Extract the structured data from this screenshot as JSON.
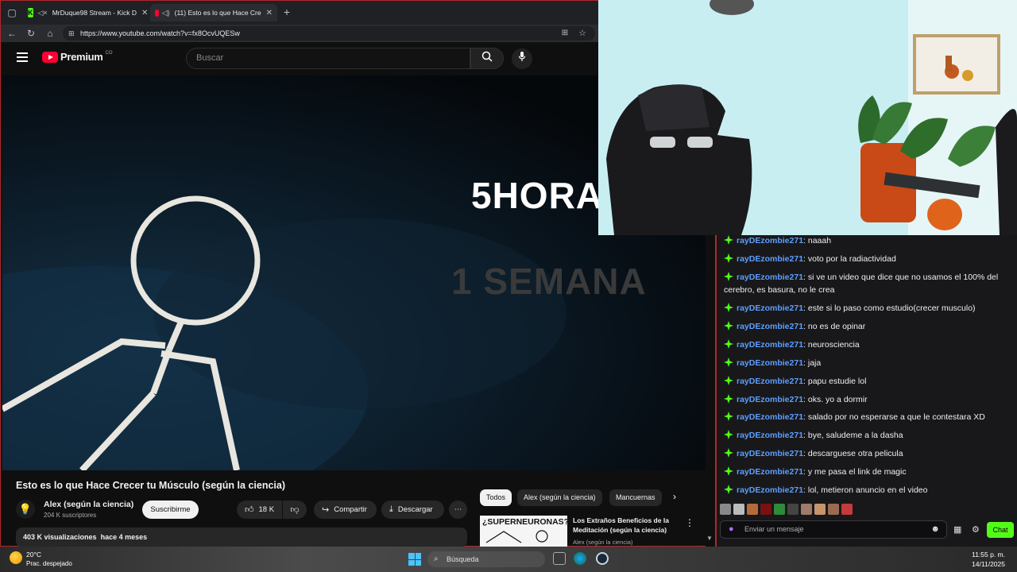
{
  "browser": {
    "tabs": [
      {
        "title": "MrDuque98 Stream - Kick D",
        "favicon": "kick-icon"
      },
      {
        "title": "(11) Esto es lo que Hace Cre",
        "favicon": "youtube-icon",
        "audio": "speaker-icon"
      }
    ],
    "url": "https://www.youtube.com/watch?v=fx8OcvUQESw"
  },
  "youtube": {
    "logo_text": "Premium",
    "logo_superscript": "CO",
    "search_placeholder": "Buscar",
    "video_overlay_text_1": "5HORA",
    "video_overlay_text_2": "1 SEMANA",
    "video_title": "Esto es lo que Hace Crecer tu Músculo (según la ciencia)",
    "channel_name": "Alex (según la ciencia)",
    "subscribers": "204 K suscriptores",
    "subscribe_label": "Suscribirme",
    "likes": "18 K",
    "share_label": "Compartir",
    "download_label": "Descargar",
    "views": "403 K visualizaciones",
    "published": "hace 4 meses",
    "chips": [
      "Todos",
      "Alex (según la ciencia)",
      "Mancuernas"
    ],
    "recommendation": {
      "thumb_text": "¿SUPERNEURONAS?",
      "title": "Los Extraños Beneficios de la Meditación (según la ciencia)",
      "channel": "Alex (según la ciencia)"
    }
  },
  "chat": {
    "username": "rayDEzombie271",
    "accent_color": "#53fc18",
    "name_color": "#5c9fff",
    "messages": [
      ": naaah",
      ": voto por la radiactividad",
      ": si ve un video que dice que no usamos el 100% del cerebro, es basura, no le crea",
      ": este si lo paso como estudio(crecer musculo)",
      ": no es de opinar",
      ": neurosciencia",
      ": jaja",
      ": papu estudie lol",
      ": oks. yo a dormir",
      ": salado por no esperarse a que le contestara XD",
      ": bye, saludeme a la dasha",
      ": descarguese otra pelicula",
      ": y me pasa el link de magic",
      ": lol, metieron anuncio en el video"
    ],
    "input_placeholder": "Enviar un mensaje",
    "send_label": "Chat"
  },
  "taskbar": {
    "temperature": "20°C",
    "weather": "Prac. despejado",
    "search_label": "Búsqueda",
    "time": "11:55 p. m.",
    "date": "14/11/2025"
  }
}
